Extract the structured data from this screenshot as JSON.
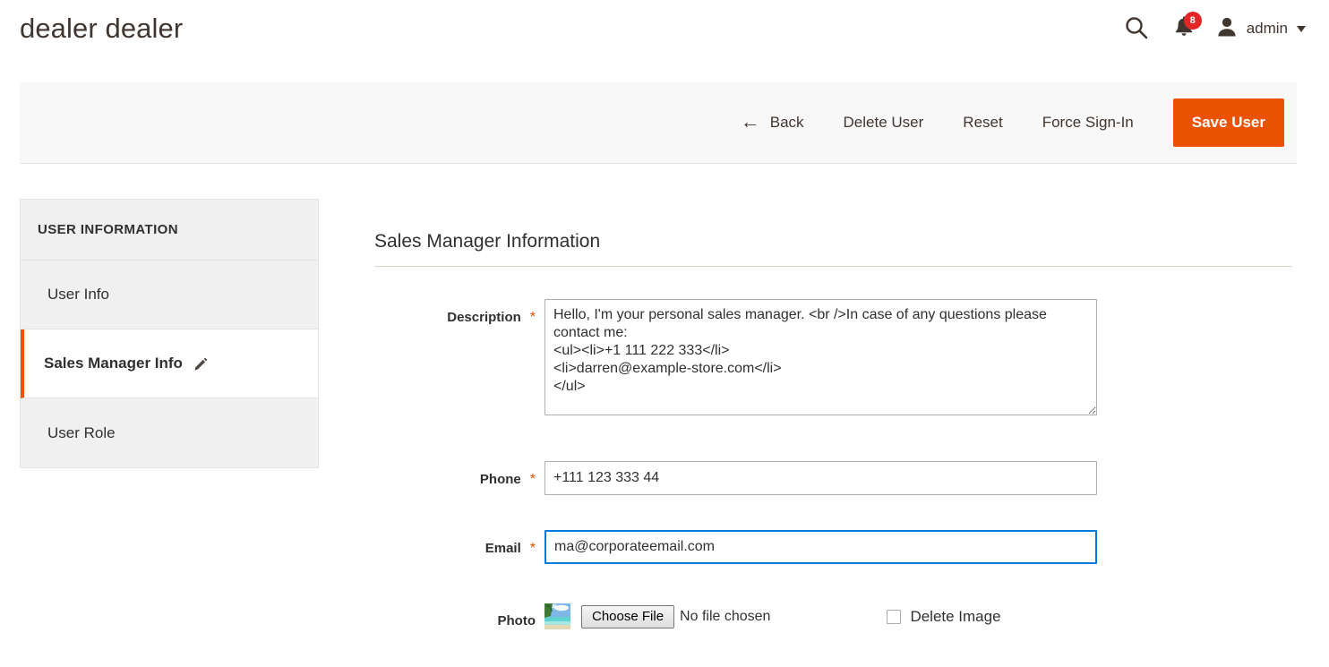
{
  "header": {
    "page_title": "dealer dealer",
    "search_icon": "search-icon",
    "notifications_icon": "bell-icon",
    "notifications_count": "8",
    "user_icon": "person-icon",
    "user_name": "admin",
    "caret_icon": "chevron-down-icon"
  },
  "toolbar": {
    "back_icon": "←",
    "back_label": "Back",
    "delete_user_label": "Delete User",
    "reset_label": "Reset",
    "force_signin_label": "Force Sign-In",
    "save_user_label": "Save User"
  },
  "sidebar": {
    "title": "USER INFORMATION",
    "items": [
      {
        "label": "User Info",
        "active": false
      },
      {
        "label": "Sales Manager Info",
        "active": true,
        "icon": "pencil-icon"
      },
      {
        "label": "User Role",
        "active": false
      }
    ]
  },
  "form": {
    "section_title": "Sales Manager Information",
    "description": {
      "label": "Description",
      "required": "*",
      "value": "Hello, I'm your personal sales manager. <br />In case of any questions please contact me:\n<ul><li>+1 111 222 333</li>\n<li>darren@example-store.com</li>\n</ul>"
    },
    "phone": {
      "label": "Phone",
      "required": "*",
      "value": "+111 123 333 44"
    },
    "email": {
      "label": "Email",
      "required": "*",
      "value": "ma@corporateemail.com",
      "focused": true
    },
    "photo": {
      "label": "Photo",
      "thumbnail_icon": "beach-photo-thumbnail",
      "choose_file_label": "Choose File",
      "no_file_text": "No file chosen",
      "delete_image_label": "Delete Image",
      "delete_image_checked": false
    }
  },
  "colors": {
    "accent": "#eb5202",
    "badge": "#e22626",
    "focus": "#007bdb",
    "text": "#303030",
    "rule": "#d6d2c4"
  }
}
